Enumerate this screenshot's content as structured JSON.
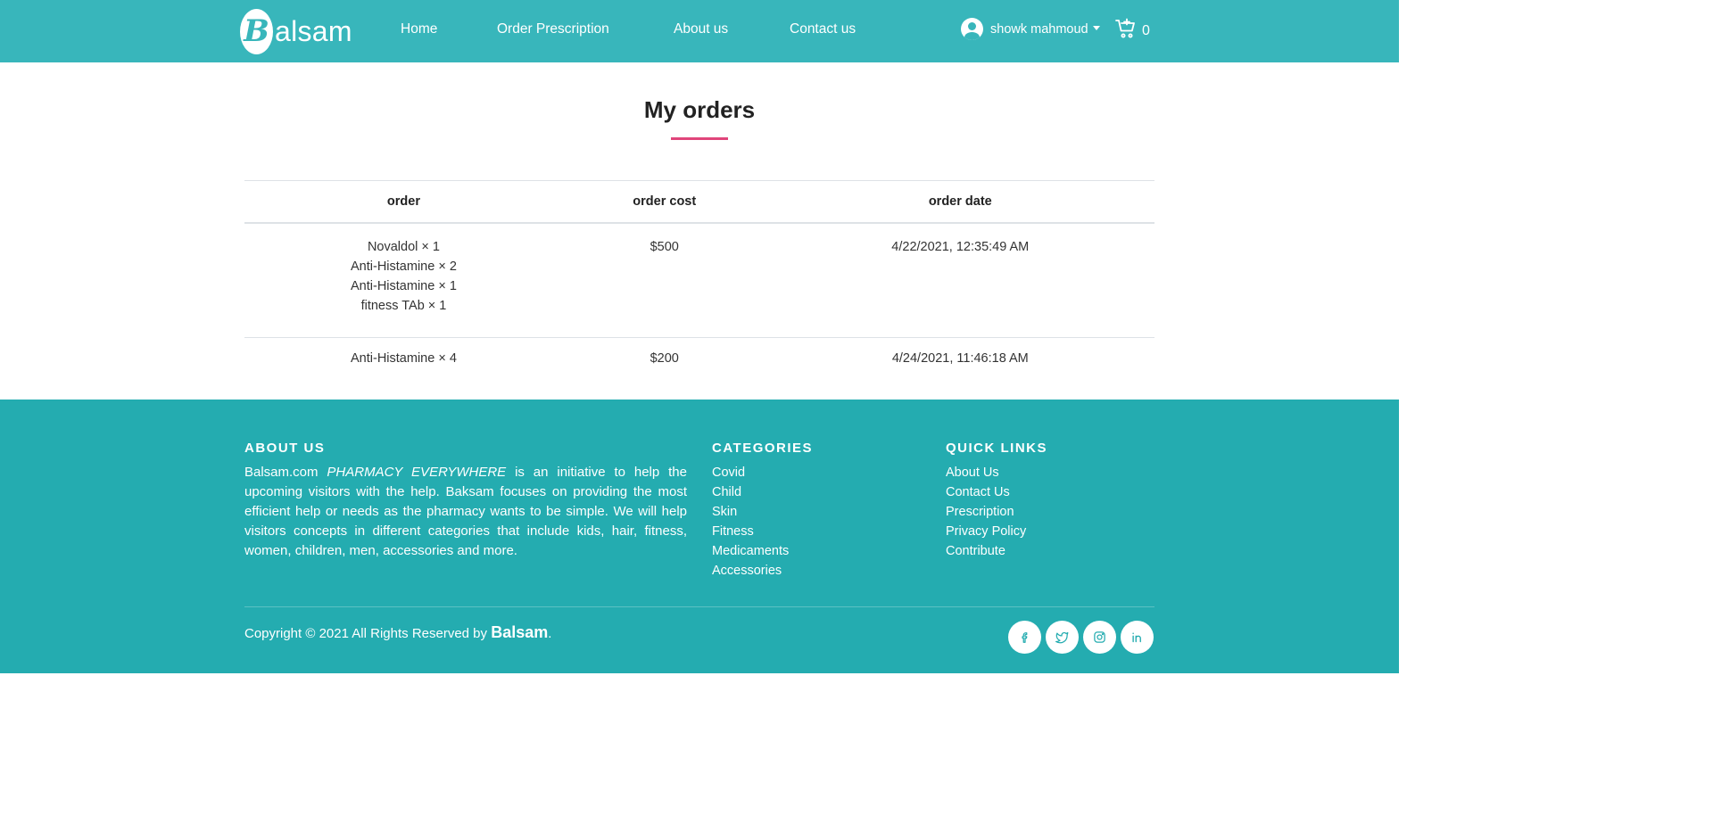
{
  "header": {
    "brand_letter": "B",
    "brand_rest": "alsam",
    "nav": [
      {
        "label": "Home"
      },
      {
        "label": "Order Prescription"
      },
      {
        "label": "About us"
      },
      {
        "label": "Contact us"
      }
    ],
    "user_name": "showk mahmoud",
    "cart_count": "0"
  },
  "main": {
    "title": "My orders",
    "columns": [
      "order",
      "order cost",
      "order date"
    ],
    "orders": [
      {
        "items": [
          "Novaldol × 1",
          "Anti-Histamine × 2",
          "Anti-Histamine × 1",
          "fitness TAb × 1"
        ],
        "cost": "$500",
        "date": "4/22/2021, 12:35:49 AM"
      },
      {
        "items": [
          "Anti-Histamine × 4"
        ],
        "cost": "$200",
        "date": "4/24/2021, 11:46:18 AM"
      }
    ]
  },
  "footer": {
    "about_heading": "ABOUT US",
    "about_text_lead": "Balsam.com ",
    "about_text_em": "PHARMACY EVERYWHERE",
    "about_text_rest": " is an initiative to help the upcoming visitors with the help. Baksam focuses on providing the most efficient help or needs as the pharmacy wants to be simple. We will help visitors concepts in different categories that include kids, hair, fitness, women, children, men, accessories and more.",
    "categories_heading": "CATEGORIES",
    "categories": [
      "Covid",
      "Child",
      "Skin",
      "Fitness",
      "Medicaments",
      "Accessories"
    ],
    "quick_heading": "QUICK LINKS",
    "quick_links": [
      "About Us",
      "Contact Us",
      "Prescription",
      "Privacy Policy",
      "Contribute"
    ],
    "copyright_text": "Copyright © 2021 All Rights Reserved by ",
    "copyright_brand": "Balsam",
    "copyright_end": ".",
    "social_icons": [
      "facebook-icon",
      "twitter-icon",
      "instagram-icon",
      "linkedin-icon"
    ]
  },
  "colors": {
    "navbar": "#38b6bb",
    "footer": "#24acb0",
    "accent_underline": "#e0457b"
  }
}
